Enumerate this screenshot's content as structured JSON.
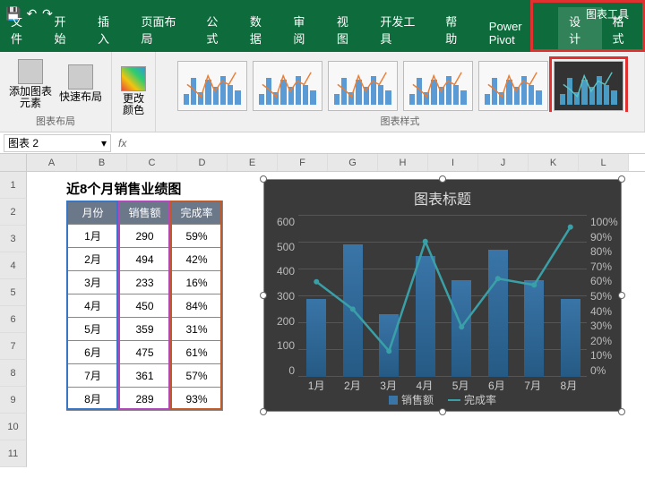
{
  "qat": {
    "save": "💾",
    "undo": "↶",
    "redo": "↷"
  },
  "context_tab": "图表工具",
  "tabs": [
    "文件",
    "开始",
    "插入",
    "页面布局",
    "公式",
    "数据",
    "审阅",
    "视图",
    "开发工具",
    "帮助",
    "Power Pivot",
    "设计",
    "格式"
  ],
  "active_tab": "设计",
  "ribbon": {
    "group1": {
      "btn1": "添加图表\n元素",
      "btn2": "快速布局",
      "label": "图表布局"
    },
    "group2": {
      "btn": "更改\n颜色"
    },
    "styles_label": "图表样式"
  },
  "name_box": "图表 2",
  "fx": "fx",
  "columns": [
    "A",
    "B",
    "C",
    "D",
    "E",
    "F",
    "G",
    "H",
    "I",
    "J",
    "K",
    "L"
  ],
  "rows": [
    "1",
    "2",
    "3",
    "4",
    "5",
    "6",
    "7",
    "8",
    "9",
    "10",
    "11"
  ],
  "sheet_title": "近8个月销售业绩图",
  "table": {
    "headers": [
      "月份",
      "销售额",
      "完成率"
    ],
    "rows": [
      [
        "1月",
        "290",
        "59%"
      ],
      [
        "2月",
        "494",
        "42%"
      ],
      [
        "3月",
        "233",
        "16%"
      ],
      [
        "4月",
        "450",
        "84%"
      ],
      [
        "5月",
        "359",
        "31%"
      ],
      [
        "6月",
        "475",
        "61%"
      ],
      [
        "7月",
        "361",
        "57%"
      ],
      [
        "8月",
        "289",
        "93%"
      ]
    ]
  },
  "chart_data": {
    "type": "combo",
    "title": "图表标题",
    "categories": [
      "1月",
      "2月",
      "3月",
      "4月",
      "5月",
      "6月",
      "7月",
      "8月"
    ],
    "series": [
      {
        "name": "销售额",
        "type": "bar",
        "axis": "left",
        "values": [
          290,
          494,
          233,
          450,
          359,
          475,
          361,
          289
        ]
      },
      {
        "name": "完成率",
        "type": "line",
        "axis": "right",
        "values": [
          59,
          42,
          16,
          84,
          31,
          61,
          57,
          93
        ]
      }
    ],
    "ylim_left": [
      0,
      600
    ],
    "yticks_left": [
      0,
      100,
      200,
      300,
      400,
      500,
      600
    ],
    "ylim_right": [
      0,
      100
    ],
    "yticks_right": [
      "0%",
      "10%",
      "20%",
      "30%",
      "40%",
      "50%",
      "60%",
      "70%",
      "80%",
      "90%",
      "100%"
    ],
    "legend": [
      "销售额",
      "完成率"
    ]
  }
}
